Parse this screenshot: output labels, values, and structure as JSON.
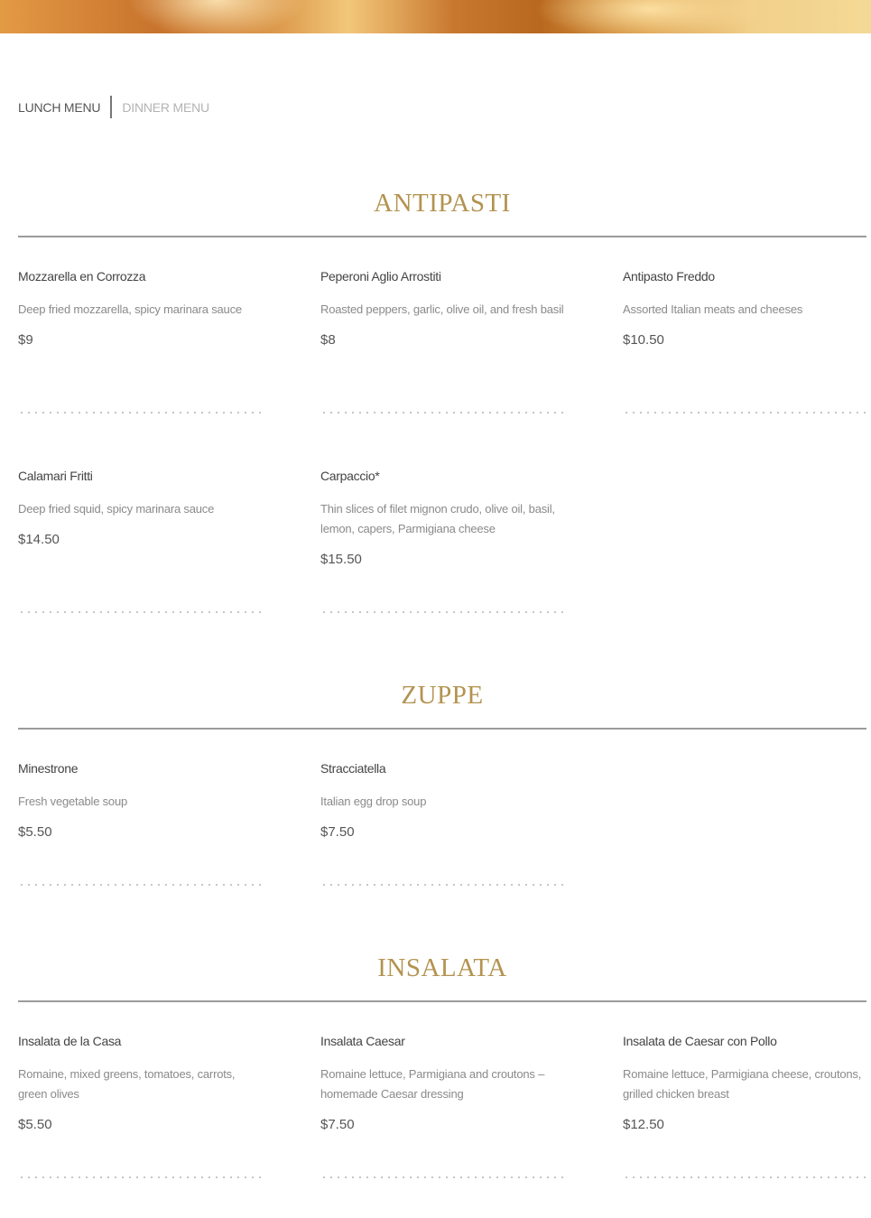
{
  "tabs": {
    "lunch": "LUNCH MENU",
    "dinner": "DINNER MENU"
  },
  "sections": {
    "antipasti": {
      "title": "ANTIPASTI",
      "items": [
        {
          "name": "Mozzarella en Corrozza",
          "desc": "Deep fried mozzarella, spicy marinara sauce",
          "price": "$9"
        },
        {
          "name": "Peperoni Aglio Arrostiti",
          "desc": "Roasted peppers, garlic, olive oil, and fresh basil",
          "price": "$8"
        },
        {
          "name": "Antipasto Freddo",
          "desc": "Assorted Italian meats and cheeses",
          "price": "$10.50"
        },
        {
          "name": "Calamari Fritti",
          "desc": "Deep fried squid, spicy marinara sauce",
          "price": "$14.50"
        },
        {
          "name": "Carpaccio*",
          "desc": "Thin slices of filet mignon crudo, olive oil, basil, lemon, capers, Parmigiana cheese",
          "price": "$15.50"
        }
      ]
    },
    "zuppe": {
      "title": "ZUPPE",
      "items": [
        {
          "name": "Minestrone",
          "desc": "Fresh vegetable soup",
          "price": "$5.50"
        },
        {
          "name": "Stracciatella",
          "desc": "Italian egg drop soup",
          "price": "$7.50"
        }
      ]
    },
    "insalata": {
      "title": "INSALATA",
      "items": [
        {
          "name": "Insalata de la Casa",
          "desc": "Romaine, mixed greens, tomatoes, carrots, green olives",
          "price": "$5.50"
        },
        {
          "name": "Insalata Caesar",
          "desc": "Romaine lettuce, Parmigiana and croutons – homemade Caesar dressing",
          "price": "$7.50"
        },
        {
          "name": "Insalata de Caesar con Pollo",
          "desc": "Romaine lettuce, Parmigiana cheese, croutons, grilled chicken breast",
          "price": "$12.50"
        }
      ]
    }
  }
}
